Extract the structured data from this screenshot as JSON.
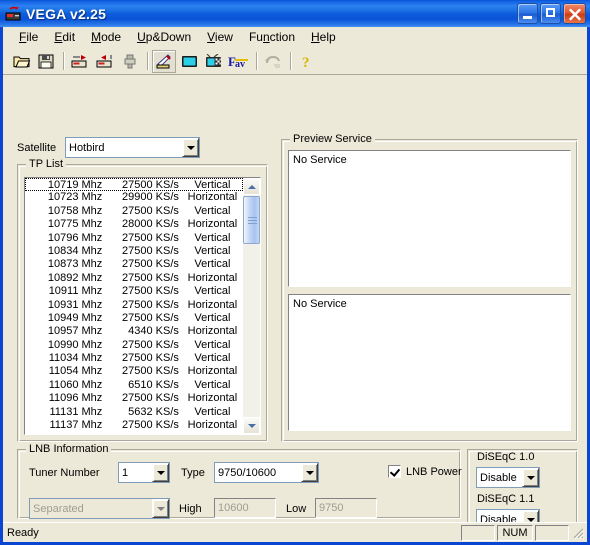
{
  "window": {
    "title": "VEGA v2.25",
    "icon": "satellite-receiver-icon",
    "minimize_label": "Minimize",
    "maximize_label": "Maximize",
    "close_label": "Close"
  },
  "menubar": {
    "items": [
      {
        "label": "File",
        "accel": "F"
      },
      {
        "label": "Edit",
        "accel": "E"
      },
      {
        "label": "Mode",
        "accel": "M"
      },
      {
        "label": "Up&Down",
        "accel": "U"
      },
      {
        "label": "View",
        "accel": "V"
      },
      {
        "label": "Function",
        "accel": "n"
      },
      {
        "label": "Help",
        "accel": "H"
      }
    ]
  },
  "toolbar": {
    "buttons": [
      {
        "name": "open-icon",
        "tip": "Open"
      },
      {
        "name": "save-icon",
        "tip": "Save"
      },
      {
        "name": "upload-to-receiver-icon",
        "tip": "Upload"
      },
      {
        "name": "download-from-receiver-icon",
        "tip": "Download"
      },
      {
        "name": "receiver-connect-icon",
        "tip": "Connect"
      },
      {
        "name": "satellite-dish-icon",
        "tip": "Satellite"
      },
      {
        "name": "tv-monitor-icon",
        "tip": "TV"
      },
      {
        "name": "tv-antenna-icon",
        "tip": "Antenna"
      },
      {
        "name": "fav-icon",
        "tip": "Favorite"
      },
      {
        "name": "undo-icon",
        "tip": "Undo"
      },
      {
        "name": "help-icon",
        "tip": "Help"
      }
    ]
  },
  "satellite": {
    "label": "Satellite",
    "value": "Hotbird"
  },
  "tp_list": {
    "title": "TP List",
    "selected_index": 0,
    "rows": [
      {
        "freq": "10719 Mhz",
        "sr": "27500 KS/s",
        "pol": "Vertical"
      },
      {
        "freq": "10723 Mhz",
        "sr": "29900 KS/s",
        "pol": "Horizontal"
      },
      {
        "freq": "10758 Mhz",
        "sr": "27500 KS/s",
        "pol": "Vertical"
      },
      {
        "freq": "10775 Mhz",
        "sr": "28000 KS/s",
        "pol": "Horizontal"
      },
      {
        "freq": "10796 Mhz",
        "sr": "27500 KS/s",
        "pol": "Vertical"
      },
      {
        "freq": "10834 Mhz",
        "sr": "27500 KS/s",
        "pol": "Vertical"
      },
      {
        "freq": "10873 Mhz",
        "sr": "27500 KS/s",
        "pol": "Vertical"
      },
      {
        "freq": "10892 Mhz",
        "sr": "27500 KS/s",
        "pol": "Horizontal"
      },
      {
        "freq": "10911 Mhz",
        "sr": "27500 KS/s",
        "pol": "Vertical"
      },
      {
        "freq": "10931 Mhz",
        "sr": "27500 KS/s",
        "pol": "Horizontal"
      },
      {
        "freq": "10949 Mhz",
        "sr": "27500 KS/s",
        "pol": "Vertical"
      },
      {
        "freq": "10957 Mhz",
        "sr": "4340 KS/s",
        "pol": "Horizontal"
      },
      {
        "freq": "10990 Mhz",
        "sr": "27500 KS/s",
        "pol": "Vertical"
      },
      {
        "freq": "11034 Mhz",
        "sr": "27500 KS/s",
        "pol": "Vertical"
      },
      {
        "freq": "11054 Mhz",
        "sr": "27500 KS/s",
        "pol": "Horizontal"
      },
      {
        "freq": "11060 Mhz",
        "sr": "6510 KS/s",
        "pol": "Vertical"
      },
      {
        "freq": "11096 Mhz",
        "sr": "27500 KS/s",
        "pol": "Horizontal"
      },
      {
        "freq": "11131 Mhz",
        "sr": "5632 KS/s",
        "pol": "Vertical"
      },
      {
        "freq": "11137 Mhz",
        "sr": "27500 KS/s",
        "pol": "Horizontal"
      }
    ]
  },
  "preview": {
    "title": "Preview Service",
    "top_text": "No Service",
    "bottom_text": "No Service"
  },
  "lnb": {
    "title": "LNB Information",
    "tuner_label": "Tuner Number",
    "tuner_value": "1",
    "type_label": "Type",
    "type_value": "9750/10600",
    "lnb_power_label": "LNB Power",
    "lnb_power_checked": true,
    "mode_value": "Separated",
    "high_label": "High",
    "high_value": "10600",
    "low_label": "Low",
    "low_value": "9750",
    "diseqc10_label": "DiSEqC 1.0",
    "diseqc10_value": "Disable",
    "diseqc11_label": "DiSEqC 1.1",
    "diseqc11_value": "Disable"
  },
  "statusbar": {
    "message": "Ready",
    "pane1": "",
    "pane2": "NUM",
    "pane3": ""
  },
  "colors": {
    "title_blue": "#0a55d6",
    "face": "#ece9d8",
    "frame": "#0a46d2",
    "close_red": "#e25a32"
  }
}
